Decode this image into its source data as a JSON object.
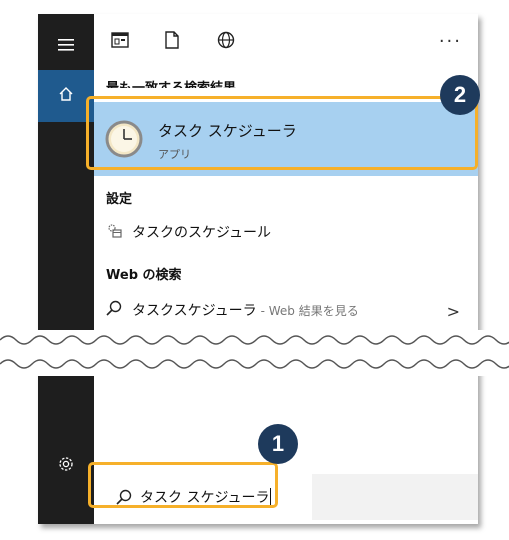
{
  "toolbar": {
    "more_label": "···"
  },
  "section_best_match": "最も一致する検索結果",
  "best_match": {
    "name": "タスク スケジューラ",
    "type": "アプリ"
  },
  "settings": {
    "header": "設定",
    "item_label": "タスクのスケジュール"
  },
  "web": {
    "header": "Web の検索",
    "query": "タスクスケジューラ",
    "hint": "- Web 結果を見る",
    "chevron": ">"
  },
  "search": {
    "value": "タスク スケジューラ"
  },
  "callouts": {
    "step1": "1",
    "step2": "2"
  },
  "colors": {
    "highlight": "#f6b02a",
    "badge": "#1e3a5c",
    "selected": "#a7d0f0",
    "rail": "#1e1e1e",
    "home_active": "#1f5a8e"
  },
  "icons": [
    "menu-icon",
    "home-icon",
    "settings-icon",
    "app-icon",
    "document-icon",
    "globe-icon",
    "clock-icon",
    "settings-task-icon",
    "search-icon"
  ]
}
